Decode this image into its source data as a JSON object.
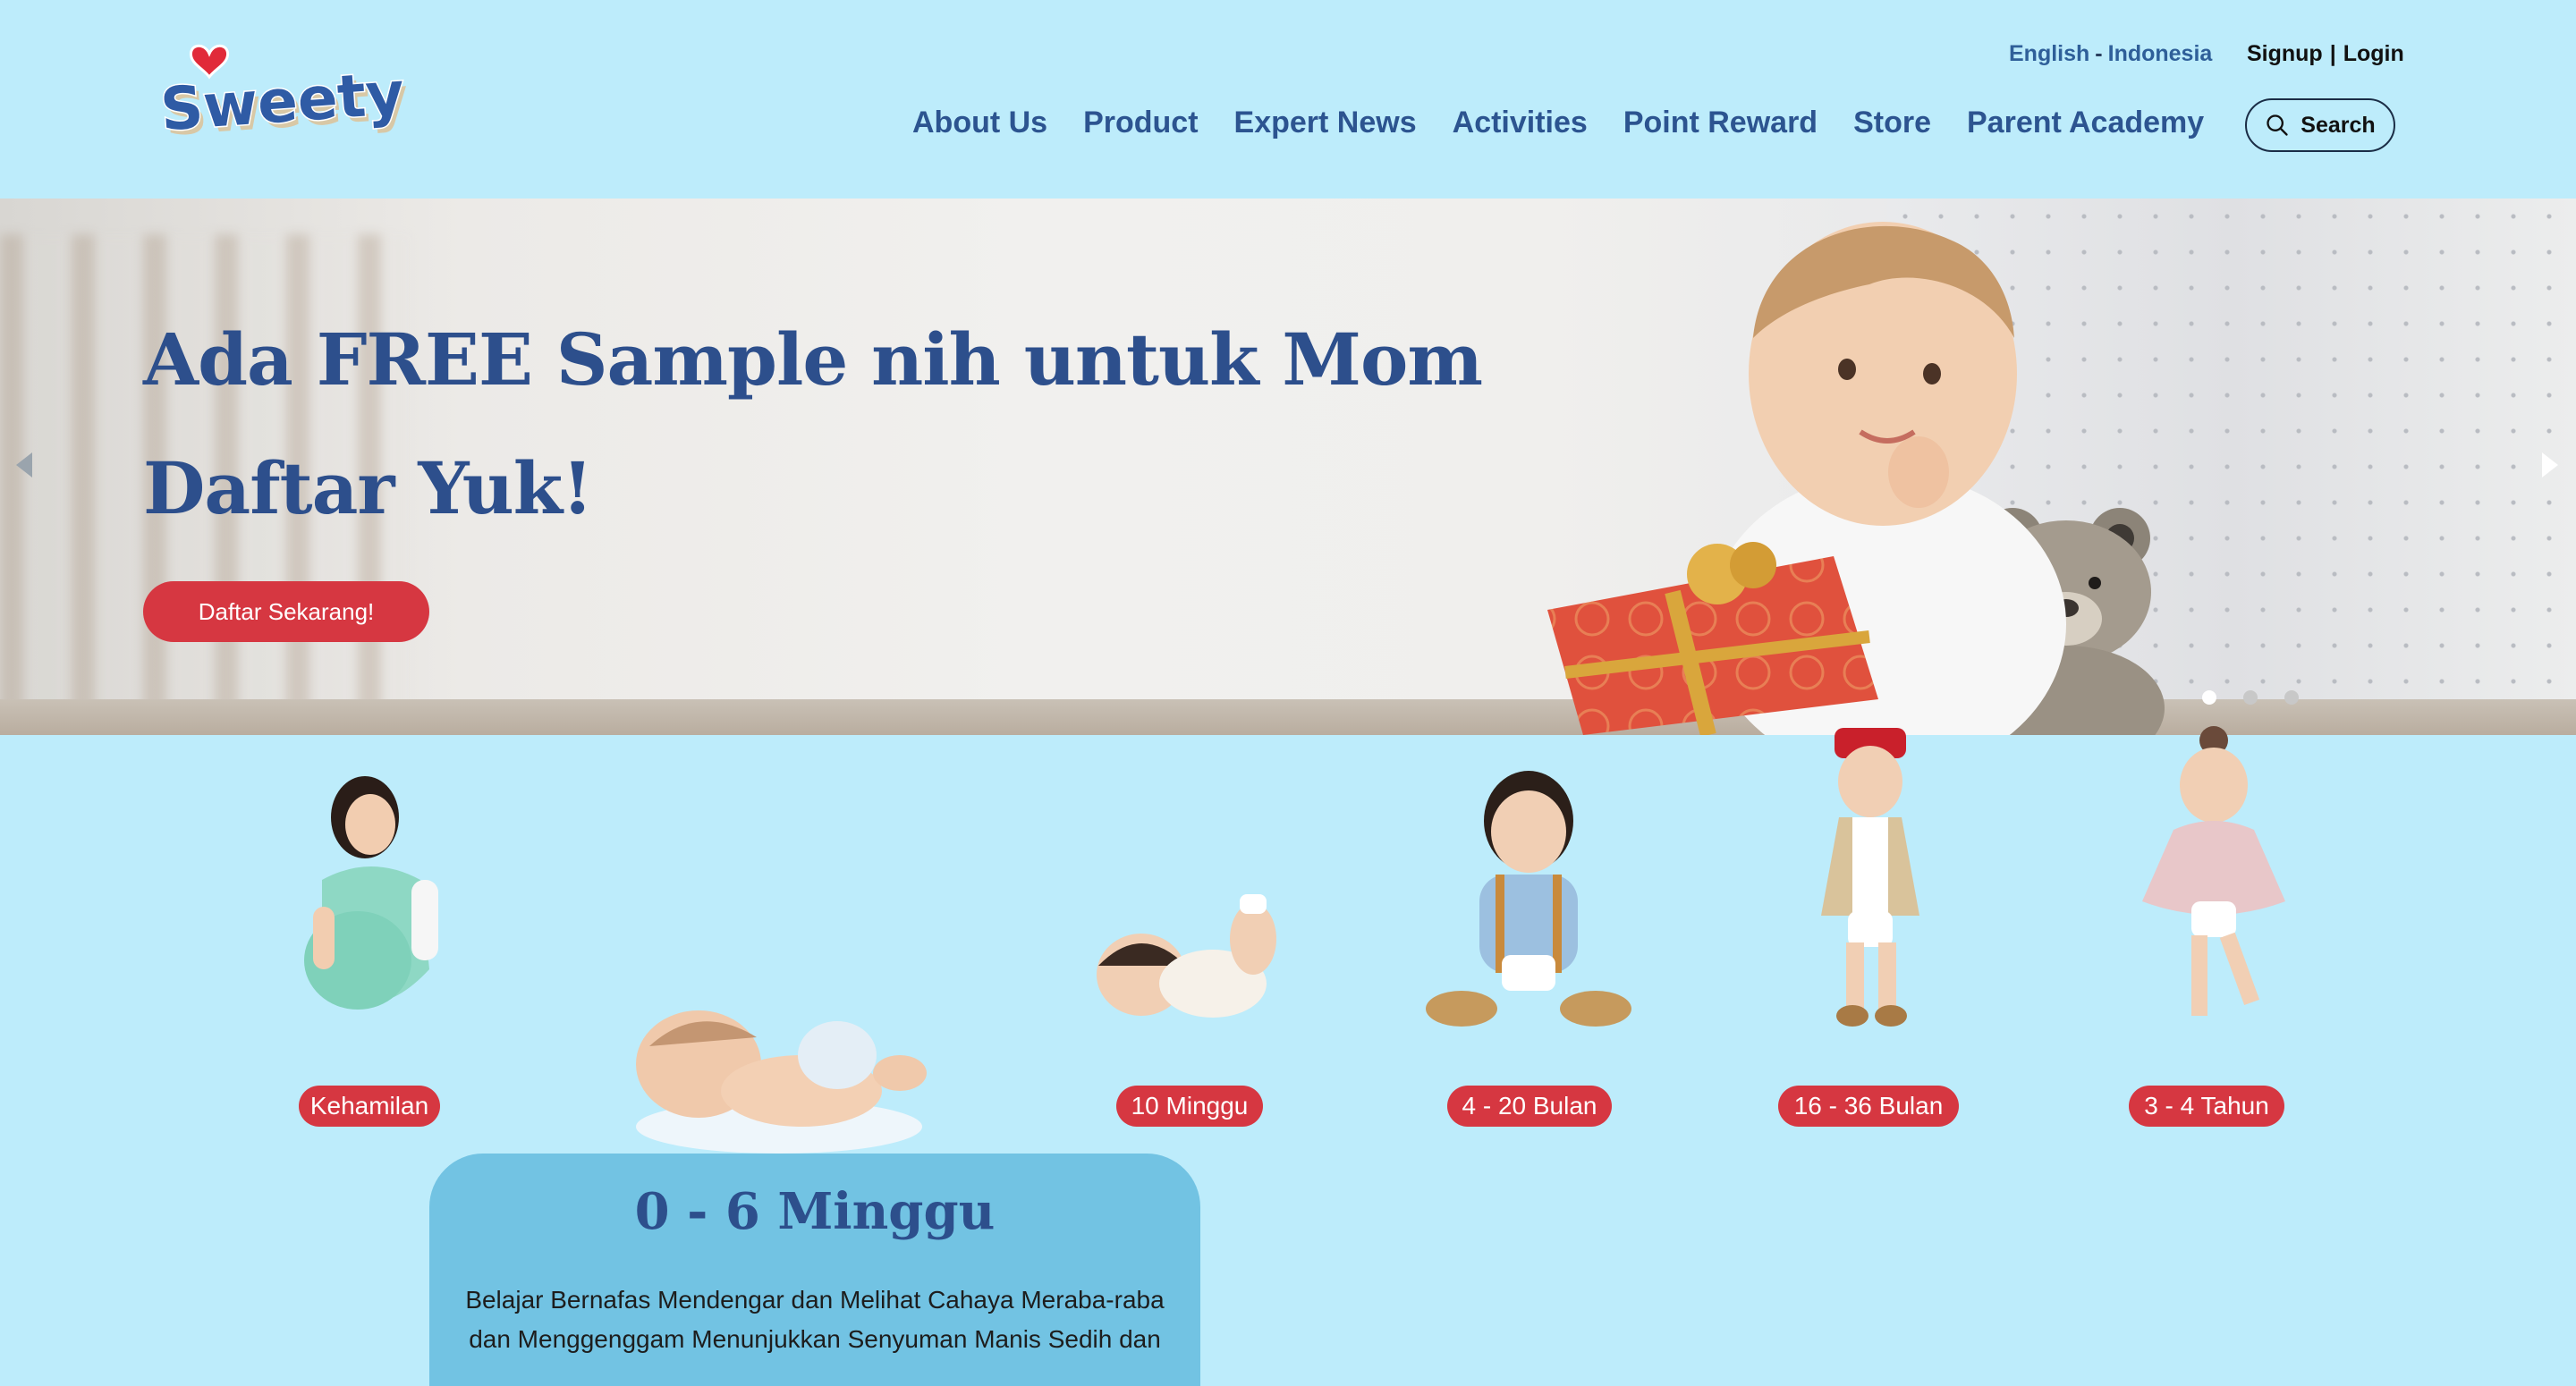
{
  "header": {
    "logo_text": "Sweety",
    "languages": [
      "English",
      "Indonesia"
    ],
    "auth": {
      "signup": "Signup",
      "login": "Login"
    },
    "nav": [
      "About Us",
      "Product",
      "Expert News",
      "Activities",
      "Point Reward",
      "Store",
      "Parent Academy"
    ],
    "search_label": "Search",
    "colors": {
      "background": "#bdecfb",
      "nav_text": "#2c5490"
    }
  },
  "hero": {
    "title_line1": "Ada FREE Sample nih untuk Mom",
    "title_line2": "Daftar Yuk!",
    "cta_label": "Daftar Sekarang!",
    "slide_count": 3,
    "active_slide": 1,
    "colors": {
      "title": "#2d4f8c",
      "cta": "#d63741"
    }
  },
  "stages": [
    {
      "label": "Kehamilan",
      "image": "pregnant-mother"
    },
    {
      "label": "0 - 6 Minggu",
      "image": "newborn-sleeping"
    },
    {
      "label": "10 Minggu",
      "image": "baby-lying"
    },
    {
      "label": "4 - 20 Bulan",
      "image": "baby-sitting"
    },
    {
      "label": "16 - 36 Bulan",
      "image": "toddler-boy"
    },
    {
      "label": "3 - 4 Tahun",
      "image": "toddler-girl"
    }
  ],
  "detail": {
    "title": "0 - 6 Minggu",
    "description": "Belajar Bernafas Mendengar dan Melihat Cahaya Meraba-raba dan Menggenggam Menunjukkan Senyuman Manis Sedih dan",
    "color": "#72c3e3"
  }
}
